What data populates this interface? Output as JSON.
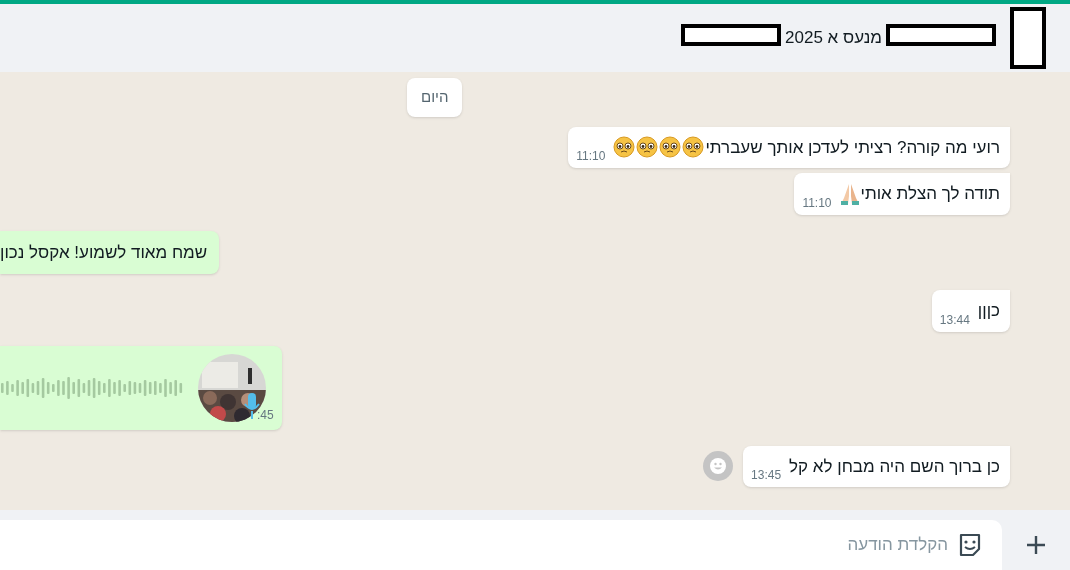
{
  "header": {
    "title": "מנעס א 2025"
  },
  "date_chip": "היום",
  "messages": [
    {
      "kind": "text",
      "outgoing": false,
      "text": "רועי מה קורה? רציתי לעדכן אותך שעברתי",
      "emojis": [
        {
          "kind": "teary"
        },
        {
          "kind": "teary"
        },
        {
          "kind": "teary"
        },
        {
          "kind": "teary"
        }
      ],
      "time": "11:10"
    },
    {
      "kind": "text",
      "outgoing": false,
      "text": "תודה לך הצלת אותי",
      "emojis": [
        {
          "kind": "pray"
        }
      ],
      "time": "11:10"
    },
    {
      "kind": "text",
      "outgoing": true,
      "text": "שמח מאוד לשמוע! אקסל נכון"
    },
    {
      "kind": "text",
      "outgoing": false,
      "text": "כןןן",
      "time": "13:44"
    },
    {
      "kind": "voice",
      "outgoing": true,
      "time": ":45"
    },
    {
      "kind": "text",
      "outgoing": false,
      "text": "כן ברוך השם היה מבחן לא קל",
      "time": "13:45",
      "reaction_button": true
    }
  ],
  "composer": {
    "placeholder": "הקלדת הודעה"
  }
}
